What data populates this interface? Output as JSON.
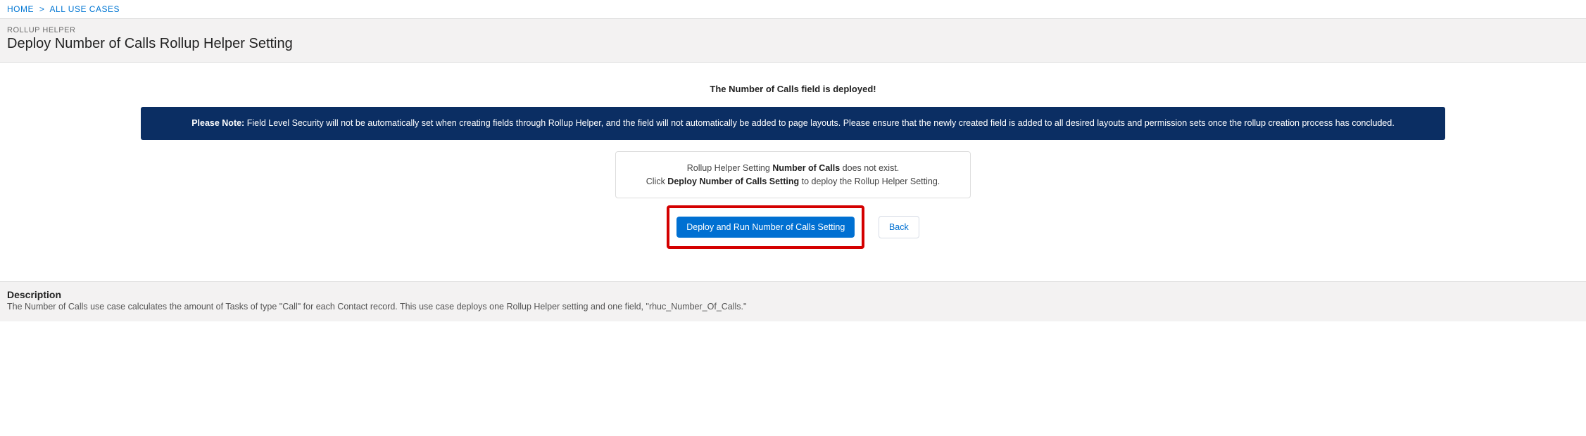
{
  "breadcrumb": {
    "home": "HOME",
    "all_use_cases": "ALL USE CASES",
    "sep": ">"
  },
  "header": {
    "app_tag": "ROLLUP HELPER",
    "page_title": "Deploy Number of Calls Rollup Helper Setting"
  },
  "main": {
    "deployed_msg": "The Number of Calls field is deployed!",
    "note_prefix": "Please Note: ",
    "note_body": "Field Level Security will not be automatically set when creating fields through Rollup Helper, and the field will not automatically be added to page layouts. Please ensure that the newly created field is added to all desired layouts and permission sets once the rollup creation process has concluded.",
    "status_l1_pre": "Rollup Helper Setting ",
    "status_l1_strong": "Number of Calls",
    "status_l1_post": " does not exist.",
    "status_l2_pre": "Click ",
    "status_l2_strong": "Deploy Number of Calls Setting",
    "status_l2_post": " to deploy the Rollup Helper Setting.",
    "deploy_btn": "Deploy and Run Number of Calls Setting",
    "back_btn": "Back"
  },
  "description": {
    "title": "Description",
    "text": "The Number of Calls use case calculates the amount of Tasks of type \"Call\" for each Contact record. This use case deploys one Rollup Helper setting and one field, \"rhuc_Number_Of_Calls.\""
  }
}
